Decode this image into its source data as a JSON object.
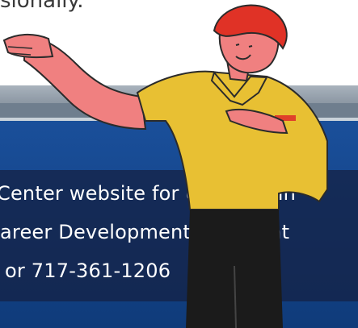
{
  "header": {
    "partial_text": "sionally."
  },
  "caption": {
    "line1": "Center website for updates an",
    "line2": "areer Development Center at",
    "line3": "or 717-361-1206"
  }
}
